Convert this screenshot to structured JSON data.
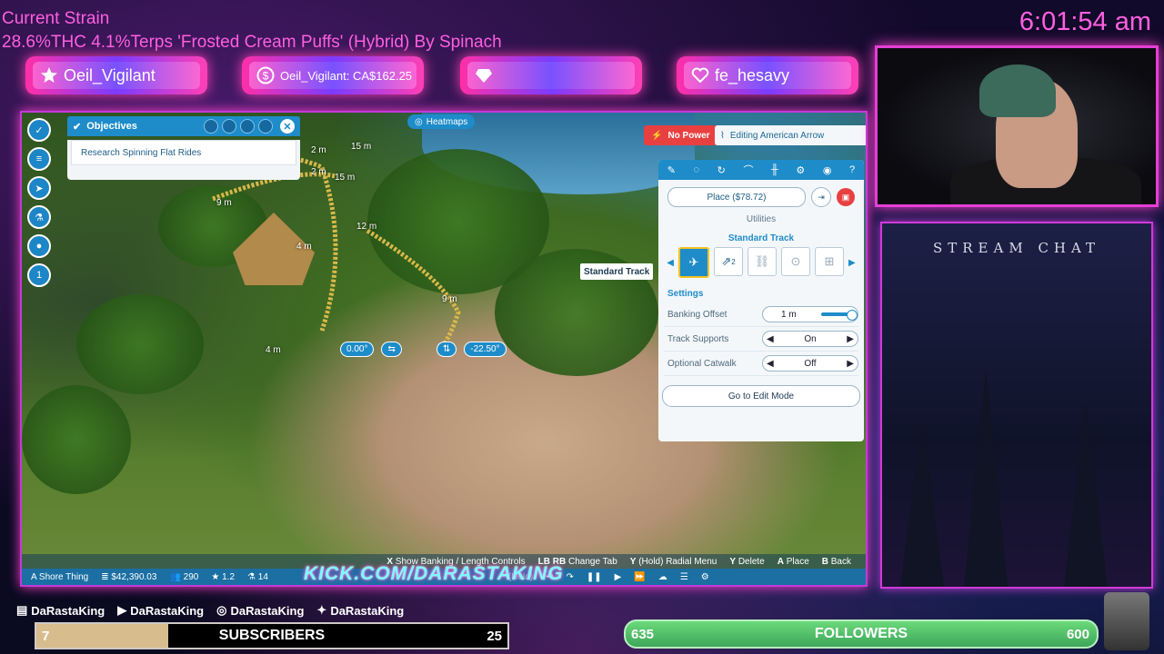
{
  "stream": {
    "strain_title": "Current Strain",
    "strain_detail": "28.6%THC 4.1%Terps 'Frosted Cream Puffs' (Hybrid) By Spinach",
    "clock": "6:01:54 am",
    "banners": [
      {
        "text": "Oeil_Vigilant",
        "icon": "star-icon"
      },
      {
        "text": "Oeil_Vigilant: CA$162.25",
        "icon": "dollar-icon"
      },
      {
        "text": "",
        "icon": "diamond-icon"
      },
      {
        "text": "fe_hesavy",
        "icon": "heart-icon"
      }
    ],
    "chat_title": "STREAM CHAT",
    "social": [
      {
        "icon": "twitch-icon",
        "name": "DaRastaKing"
      },
      {
        "icon": "youtube-icon",
        "name": "DaRastaKing"
      },
      {
        "icon": "instagram-icon",
        "name": "DaRastaKing"
      },
      {
        "icon": "twitter-icon",
        "name": "DaRastaKing"
      }
    ],
    "subs": {
      "current": "7",
      "label": "SUBSCRIBERS",
      "goal": "25",
      "progress": 0.28
    },
    "followers": {
      "current": "635",
      "label": "FOLLOWERS",
      "goal": "600"
    },
    "kick": "KICK.COM/DARASTAKING"
  },
  "game": {
    "objectives": {
      "title": "Objectives",
      "item": "Research Spinning Flat Rides"
    },
    "heatmaps": "Heatmaps",
    "left_badge": "1",
    "measurements": [
      "2 m",
      "15 m",
      "2 m",
      "15 m",
      "9 m",
      "12 m",
      "4 m",
      "9 m",
      "4 m"
    ],
    "banking_left": "0.00°",
    "banking_right": "-22.50°",
    "no_power": "No Power",
    "editing": "Editing American Arrow",
    "tooltip": "Standard Track",
    "panel": {
      "place_label": "Place ($78.72)",
      "utilities": "Utilities",
      "track_section": "Standard Track",
      "piece_badge": "2",
      "settings_title": "Settings",
      "settings": [
        {
          "label": "Banking Offset",
          "value": "1 m"
        },
        {
          "label": "Track Supports",
          "value": "On"
        },
        {
          "label": "Optional Catwalk",
          "value": "Off"
        }
      ],
      "edit_mode": "Go to Edit Mode"
    },
    "hints": [
      {
        "key": "X",
        "text": "Show Banking / Length Controls"
      },
      {
        "key": "LB RB",
        "text": "Change Tab"
      },
      {
        "key": "Y",
        "text": "(Hold)  Radial Menu"
      },
      {
        "key": "Y",
        "text": "Delete"
      },
      {
        "key": "A",
        "text": "Place"
      },
      {
        "key": "B",
        "text": "Back"
      }
    ],
    "status": {
      "park_name": "A Shore Thing",
      "money": "$42,390.03",
      "guests": "290",
      "rating": "1.2",
      "staff": "14",
      "hold": "(Hold)"
    }
  },
  "colors": {
    "accent": "#1e8cc9",
    "neon": "#ff3fd0",
    "strain_text": "#ff5fe0"
  }
}
